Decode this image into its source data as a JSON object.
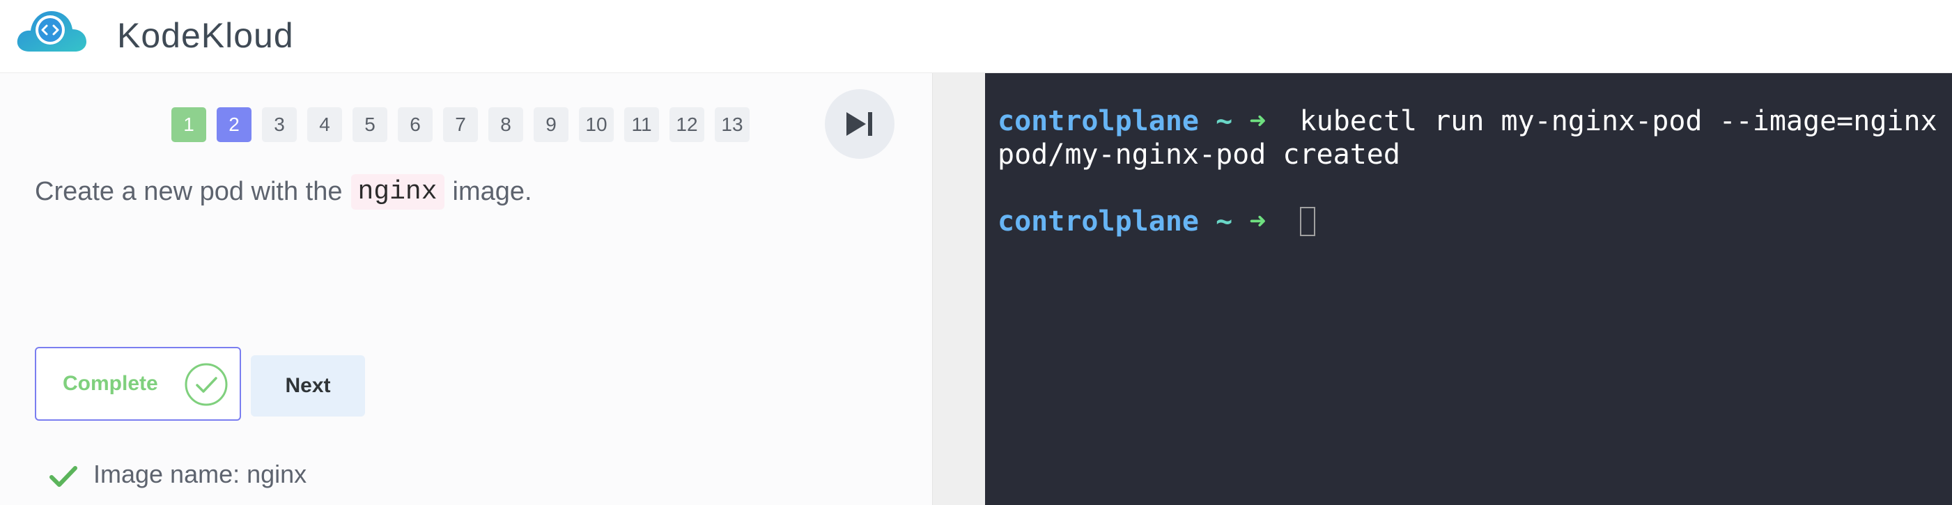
{
  "app": {
    "brand": "KodeKloud"
  },
  "steps": {
    "items": [
      "1",
      "2",
      "3",
      "4",
      "5",
      "6",
      "7",
      "8",
      "9",
      "10",
      "11",
      "12",
      "13"
    ],
    "done": [
      1
    ],
    "active": 2
  },
  "question": {
    "before": "Create a new pod with the",
    "code": "nginx",
    "after": "image."
  },
  "buttons": {
    "complete_label": "Complete",
    "next_label": "Next"
  },
  "results": [
    {
      "label": "Image name: nginx",
      "status": "passed"
    }
  ],
  "terminal": {
    "lines": [
      {
        "host": "controlplane",
        "tilde": "~",
        "arrow": "➜",
        "command": " kubectl run my-nginx-pod --image=nginx"
      },
      {
        "output": "pod/my-nginx-pod created"
      },
      {
        "host": "controlplane",
        "tilde": "~",
        "arrow": "➜",
        "command": ""
      }
    ]
  },
  "colors": {
    "accent": "#7b86f3",
    "success": "#8ed18e",
    "complete_text": "#7fd07d",
    "terminal_bg": "#292c37",
    "prompt_host": "#67b5f5",
    "prompt_arrow": "#6fe080"
  },
  "icons": {
    "logo": "cloud-code-icon",
    "skip": "skip-forward-icon",
    "complete": "check-circle-icon",
    "result": "checkmark-icon"
  }
}
